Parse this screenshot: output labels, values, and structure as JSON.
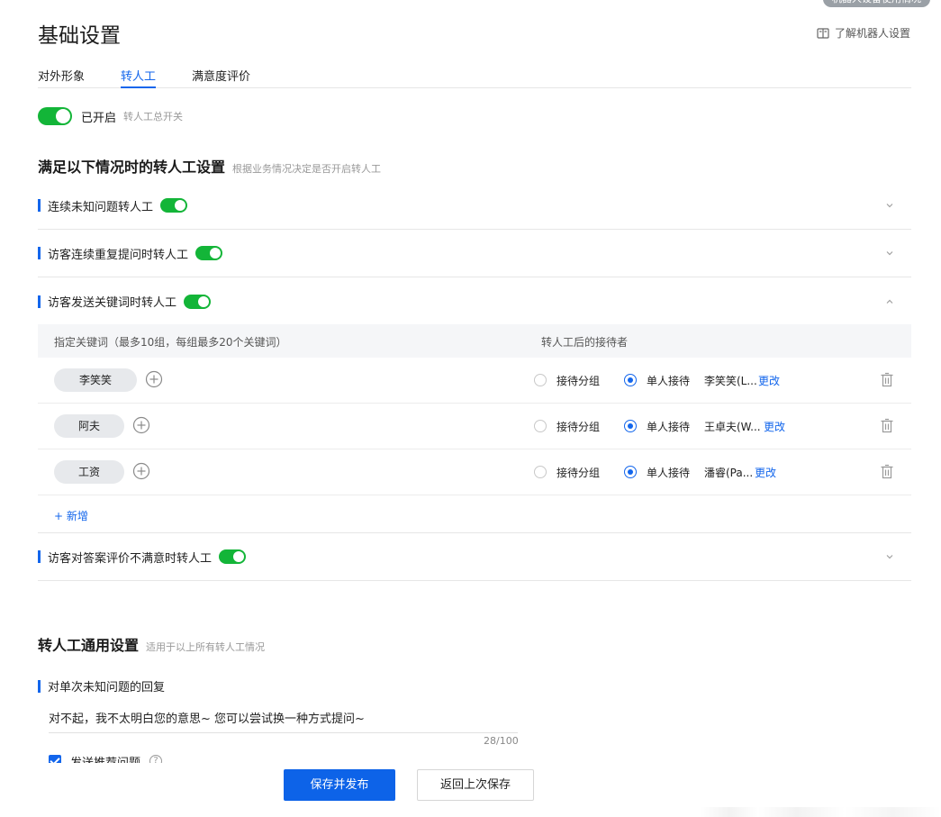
{
  "top_badge": "机器人设备使用情况",
  "page_title": "基础设置",
  "help_link": "了解机器人设置",
  "tabs": [
    {
      "label": "对外形象",
      "active": false
    },
    {
      "label": "转人工",
      "active": true
    },
    {
      "label": "满意度评价",
      "active": false
    }
  ],
  "master_switch": {
    "label": "已开启",
    "hint": "转人工总开关",
    "on": true
  },
  "conditions_section": {
    "title": "满足以下情况时的转人工设置",
    "subtitle": "根据业务情况决定是否开启转人工"
  },
  "rules": [
    {
      "label": "连续未知问题转人工",
      "on": true,
      "expanded": false
    },
    {
      "label": "访客连续重复提问时转人工",
      "on": true,
      "expanded": false
    },
    {
      "label": "访客发送关键词时转人工",
      "on": true,
      "expanded": true
    },
    {
      "label": "访客对答案评价不满意时转人工",
      "on": true,
      "expanded": false
    }
  ],
  "keyword_table": {
    "col_keywords": "指定关键词（最多10组，每组最多20个关键词）",
    "col_receiver": "转人工后的接待者",
    "option_group": "接待分组",
    "option_single": "单人接待",
    "change_label": "更改",
    "rows": [
      {
        "keyword": "李笑笑",
        "selected": "single",
        "agent": "李笑笑(L..."
      },
      {
        "keyword": "阿夫",
        "selected": "single",
        "agent": "王卓夫(W..."
      },
      {
        "keyword": "工资",
        "selected": "single",
        "agent": "潘睿(Pa..."
      }
    ],
    "add_label": "+ 新增"
  },
  "general_section": {
    "title": "转人工通用设置",
    "subtitle": "适用于以上所有转人工情况"
  },
  "unknown_reply": {
    "heading": "对单次未知问题的回复",
    "text": "对不起，我不太明白您的意思~ 您可以尝试换一种方式提问~",
    "counter": "28/100"
  },
  "send_recommend": {
    "label": "发送推荐问题",
    "checked": true
  },
  "footer": {
    "primary": "保存并发布",
    "secondary": "返回上次保存"
  },
  "colors": {
    "accent": "#1366ec",
    "toggle_on": "#13b538"
  }
}
